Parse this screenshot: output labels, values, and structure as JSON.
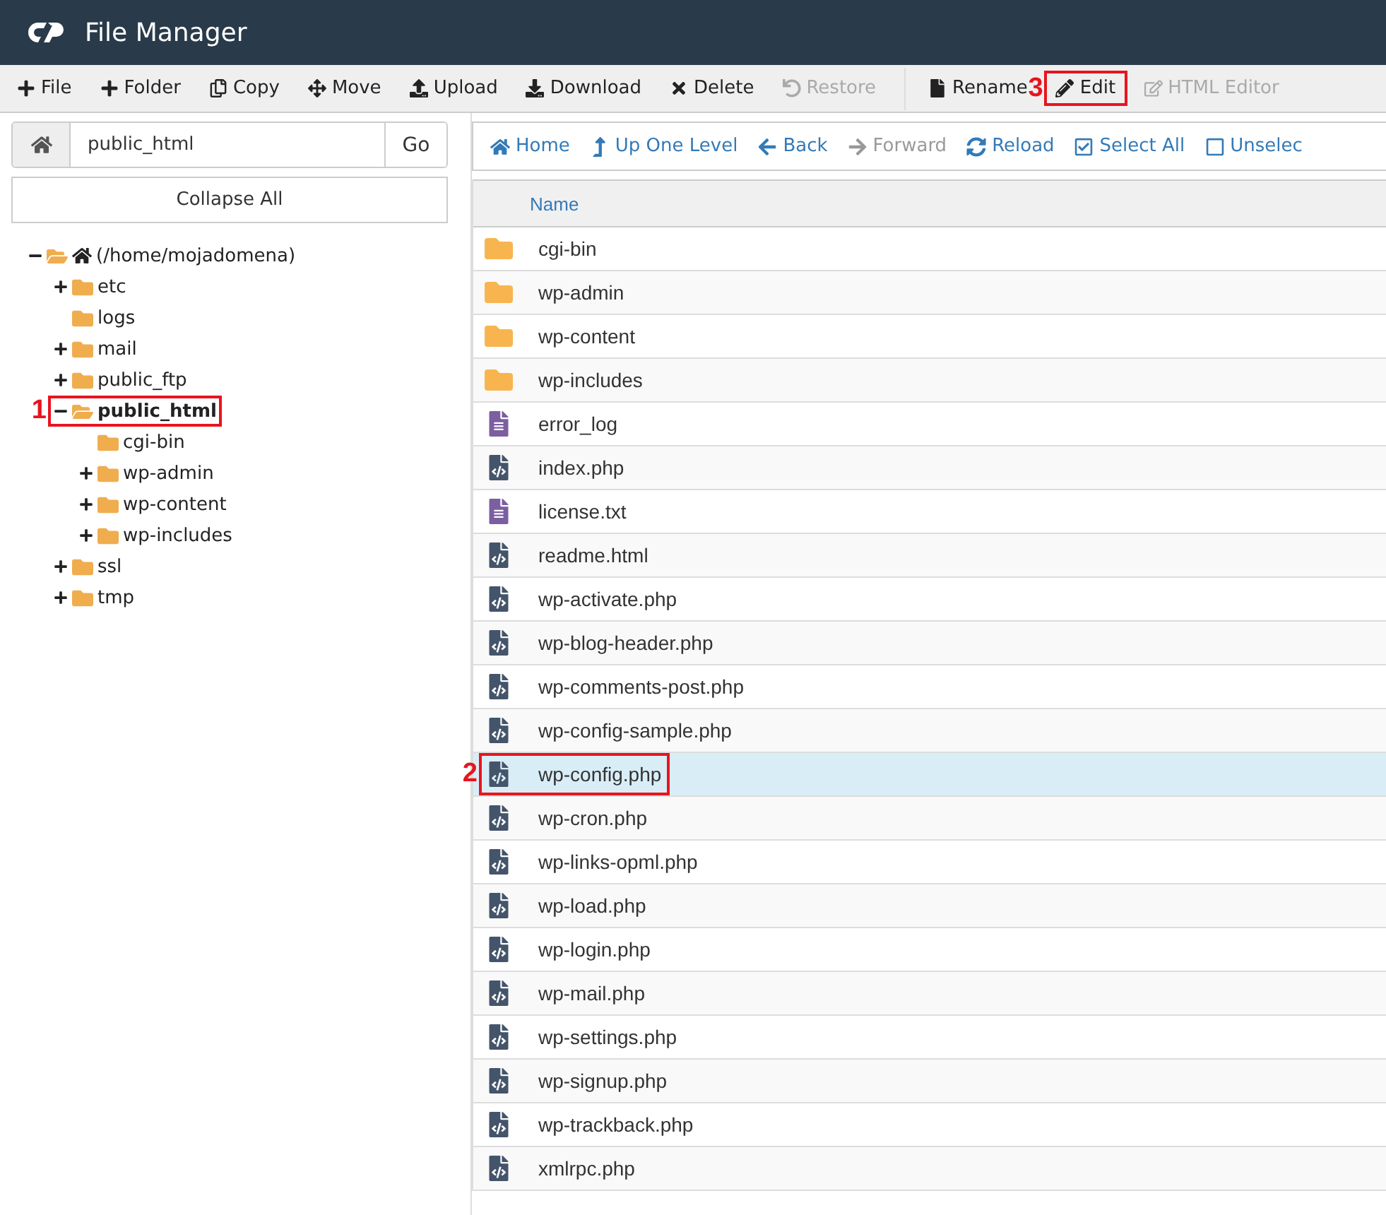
{
  "header": {
    "title": "File Manager"
  },
  "toolbar": [
    {
      "label": "File",
      "disabled": false
    },
    {
      "label": "Folder",
      "disabled": false
    },
    {
      "label": "Copy",
      "disabled": false
    },
    {
      "label": "Move",
      "disabled": false
    },
    {
      "label": "Upload",
      "disabled": false
    },
    {
      "label": "Download",
      "disabled": false
    },
    {
      "label": "Delete",
      "disabled": false
    },
    {
      "label": "Restore",
      "disabled": true
    },
    {
      "label": "Rename",
      "disabled": false
    },
    {
      "label": "Edit",
      "disabled": false,
      "callout": "3"
    },
    {
      "label": "HTML Editor",
      "disabled": true
    }
  ],
  "path_bar": {
    "value": "public_html",
    "go": "Go"
  },
  "collapse_button": "Collapse All",
  "tree": [
    {
      "label": "(/home/mojadomena)",
      "expandable": true,
      "expanded": true,
      "selected": false,
      "children": [
        {
          "label": "etc",
          "expandable": true,
          "expanded": false,
          "selected": false
        },
        {
          "label": "logs",
          "expandable": false,
          "expanded": false,
          "selected": false
        },
        {
          "label": "mail",
          "expandable": true,
          "expanded": false,
          "selected": false
        },
        {
          "label": "public_ftp",
          "expandable": true,
          "expanded": false,
          "selected": false
        },
        {
          "label": "public_html",
          "expandable": true,
          "expanded": true,
          "selected": true,
          "callout": "1",
          "children": [
            {
              "label": "cgi-bin",
              "expandable": false,
              "expanded": false,
              "selected": false
            },
            {
              "label": "wp-admin",
              "expandable": true,
              "expanded": false,
              "selected": false
            },
            {
              "label": "wp-content",
              "expandable": true,
              "expanded": false,
              "selected": false
            },
            {
              "label": "wp-includes",
              "expandable": true,
              "expanded": false,
              "selected": false
            }
          ]
        },
        {
          "label": "ssl",
          "expandable": true,
          "expanded": false,
          "selected": false
        },
        {
          "label": "tmp",
          "expandable": true,
          "expanded": false,
          "selected": false
        }
      ]
    }
  ],
  "nav": [
    {
      "label": "Home",
      "disabled": false
    },
    {
      "label": "Up One Level",
      "disabled": false
    },
    {
      "label": "Back",
      "disabled": false
    },
    {
      "label": "Forward",
      "disabled": true
    },
    {
      "label": "Reload",
      "disabled": false
    },
    {
      "label": "Select All",
      "disabled": false
    },
    {
      "label": "Unselec",
      "disabled": false
    }
  ],
  "table": {
    "columns": [
      "Name"
    ],
    "rows": [
      {
        "name": "cgi-bin",
        "kind": "folder",
        "selected": false
      },
      {
        "name": "wp-admin",
        "kind": "folder",
        "selected": false
      },
      {
        "name": "wp-content",
        "kind": "folder",
        "selected": false
      },
      {
        "name": "wp-includes",
        "kind": "folder",
        "selected": false
      },
      {
        "name": "error_log",
        "kind": "text",
        "selected": false
      },
      {
        "name": "index.php",
        "kind": "code",
        "selected": false
      },
      {
        "name": "license.txt",
        "kind": "text",
        "selected": false
      },
      {
        "name": "readme.html",
        "kind": "code",
        "selected": false
      },
      {
        "name": "wp-activate.php",
        "kind": "code",
        "selected": false
      },
      {
        "name": "wp-blog-header.php",
        "kind": "code",
        "selected": false
      },
      {
        "name": "wp-comments-post.php",
        "kind": "code",
        "selected": false
      },
      {
        "name": "wp-config-sample.php",
        "kind": "code",
        "selected": false
      },
      {
        "name": "wp-config.php",
        "kind": "code",
        "selected": true,
        "callout": "2"
      },
      {
        "name": "wp-cron.php",
        "kind": "code",
        "selected": false
      },
      {
        "name": "wp-links-opml.php",
        "kind": "code",
        "selected": false
      },
      {
        "name": "wp-load.php",
        "kind": "code",
        "selected": false
      },
      {
        "name": "wp-login.php",
        "kind": "code",
        "selected": false
      },
      {
        "name": "wp-mail.php",
        "kind": "code",
        "selected": false
      },
      {
        "name": "wp-settings.php",
        "kind": "code",
        "selected": false
      },
      {
        "name": "wp-signup.php",
        "kind": "code",
        "selected": false
      },
      {
        "name": "wp-trackback.php",
        "kind": "code",
        "selected": false
      },
      {
        "name": "xmlrpc.php",
        "kind": "code",
        "selected": false
      }
    ]
  }
}
